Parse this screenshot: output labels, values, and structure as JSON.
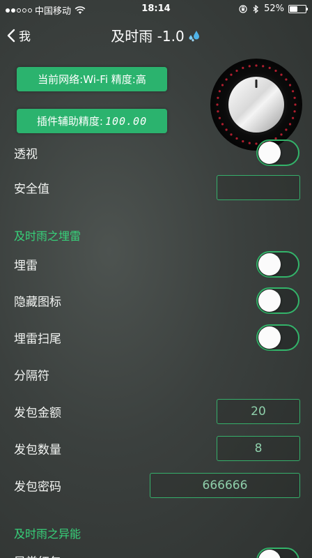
{
  "status_bar": {
    "carrier": "中国移动",
    "time": "18:14",
    "battery": "52%",
    "battery_level": 0.52
  },
  "nav": {
    "back_label": "我",
    "title": "及时雨 -1.0"
  },
  "info": {
    "network_label": "当前网络:Wi-Fi 精度:高",
    "accuracy_label": "插件辅助精度:",
    "accuracy_value": "100.00"
  },
  "rows": {
    "perspective": {
      "label": "透视",
      "on": false
    },
    "safety": {
      "label": "安全值",
      "value": ""
    }
  },
  "section_mine": {
    "title": "及时雨之埋雷",
    "mine": {
      "label": "埋雷",
      "on": false
    },
    "hide_icon": {
      "label": "隐藏图标",
      "on": false
    },
    "mine_tail": {
      "label": "埋雷扫尾",
      "on": false
    },
    "separator": {
      "label": "分隔符"
    },
    "amount": {
      "label": "发包金额",
      "value": "20"
    },
    "count": {
      "label": "发包数量",
      "value": "8"
    },
    "password": {
      "label": "发包密码",
      "value": "666666"
    }
  },
  "section_ability": {
    "title": "及时雨之异能",
    "first_row": {
      "label": "异常红包",
      "on": false
    }
  },
  "colors": {
    "accent": "#2bb36e",
    "section_title": "#37d27a",
    "background": "#3b403e"
  },
  "icons": {
    "back": "chevron-left-icon",
    "title": "water-drops-icon",
    "knob": "volume-knob-icon"
  }
}
